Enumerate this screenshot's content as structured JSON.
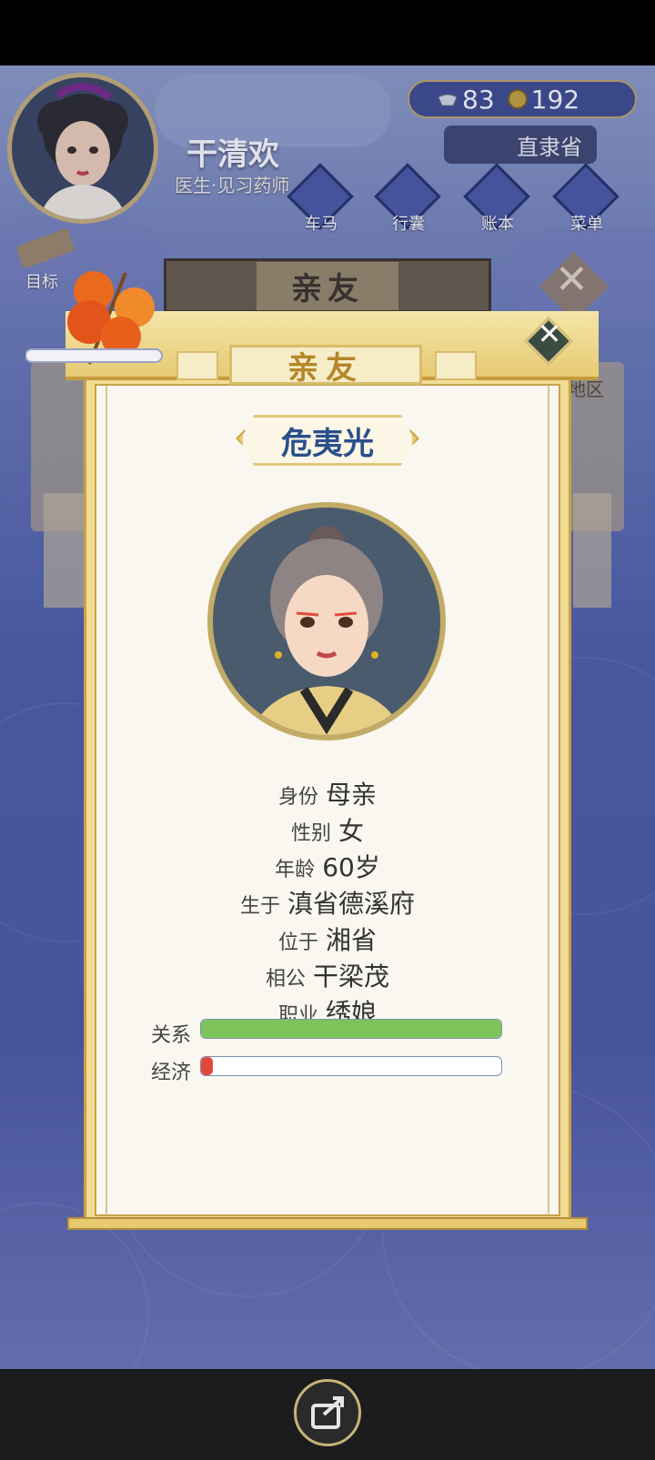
{
  "hud": {
    "player_name": "干清欢",
    "player_title": "医生·见习药师",
    "silver": "83",
    "coins": "192",
    "location": "直隶省",
    "goal_label": "目标",
    "menu": [
      {
        "label": "车马",
        "icon": "carriage-icon"
      },
      {
        "label": "行囊",
        "icon": "bag-icon"
      },
      {
        "label": "账本",
        "icon": "ledger-icon"
      },
      {
        "label": "菜单",
        "icon": "more-icon"
      }
    ],
    "background_header": "亲友",
    "background_region": "地区"
  },
  "popup": {
    "tab_title": "亲友",
    "person_name": "危夷光",
    "details": [
      {
        "key": "身份",
        "value": "母亲"
      },
      {
        "key": "性别",
        "value": "女"
      },
      {
        "key": "年龄",
        "value": "60岁"
      },
      {
        "key": "生于",
        "value": "滇省德溪府"
      },
      {
        "key": "位于",
        "value": "湘省"
      },
      {
        "key": "相公",
        "value": "干梁茂"
      },
      {
        "key": "职业",
        "value": "绣娘"
      }
    ],
    "bars": [
      {
        "label": "关系",
        "value": 1.0,
        "color": "#7cc35a"
      },
      {
        "label": "经济",
        "value": 0.04,
        "color": "#e0493a"
      }
    ]
  },
  "colors": {
    "panel_gold": "#e7ca73",
    "name_blue": "#2a4f8a",
    "tab_gold": "#b5862a"
  }
}
